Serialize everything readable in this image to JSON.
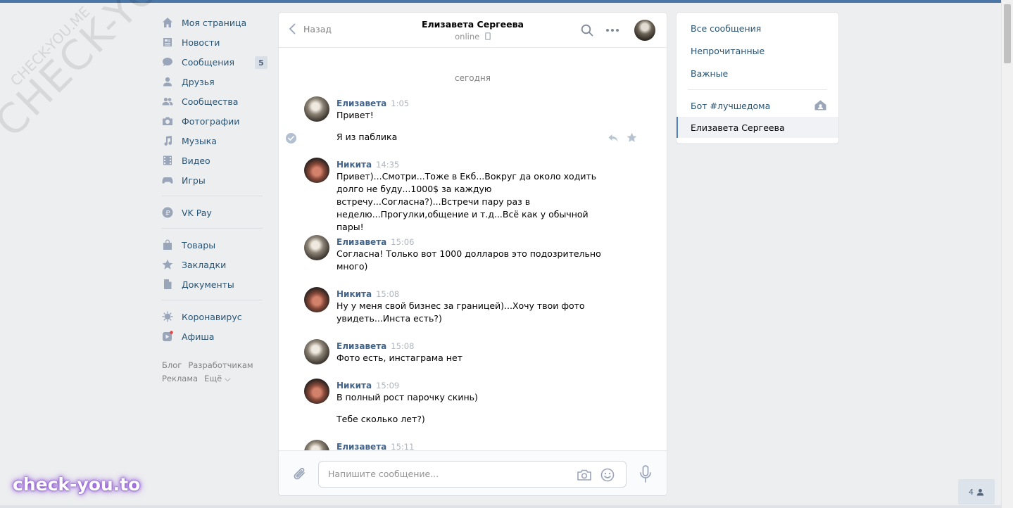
{
  "watermark": {
    "text_big": "CHECK-YOU.ME",
    "text_small": "CHECK-YOU.ME",
    "logo": "check-you.to"
  },
  "leftnav": {
    "items": [
      {
        "label": "Моя страница",
        "icon": "home-icon"
      },
      {
        "label": "Новости",
        "icon": "news-icon"
      },
      {
        "label": "Сообщения",
        "icon": "messages-icon",
        "badge": "5"
      },
      {
        "label": "Друзья",
        "icon": "friends-icon"
      },
      {
        "label": "Сообщества",
        "icon": "groups-icon"
      },
      {
        "label": "Фотографии",
        "icon": "camera-icon"
      },
      {
        "label": "Музыка",
        "icon": "music-icon"
      },
      {
        "label": "Видео",
        "icon": "video-icon"
      },
      {
        "label": "Игры",
        "icon": "games-icon"
      },
      {
        "label": "VK Pay",
        "icon": "vkpay-icon"
      },
      {
        "label": "Товары",
        "icon": "bag-icon"
      },
      {
        "label": "Закладки",
        "icon": "star-icon"
      },
      {
        "label": "Документы",
        "icon": "document-icon"
      },
      {
        "label": "Коронавирус",
        "icon": "virus-icon"
      },
      {
        "label": "Афиша",
        "icon": "afisha-icon"
      }
    ],
    "footer": {
      "blog": "Блог",
      "dev": "Разработчикам",
      "ads": "Реклама",
      "more": "Ещё ⌵"
    }
  },
  "chat": {
    "back": "Назад",
    "peer_name": "Елизавета Сергеева",
    "peer_status": "online",
    "date_label": "сегодня",
    "messages": [
      {
        "author": "Елизавета",
        "time": "1:05",
        "text": "Привет!",
        "text2": "Я из паблика"
      },
      {
        "author": "Никита",
        "time": "14:35",
        "text": "Привет)...Смотри...Тоже в Екб...Вокруг да около ходить долго не буду...1000$ за каждую встречу...Согласна?)...Встречи пару раз в неделю...Прогулки,общение и т.д...Всё как у обычной пары!"
      },
      {
        "author": "Елизавета",
        "time": "15:06",
        "text": "Согласна! Только вот 1000 долларов это подозрительно много)"
      },
      {
        "author": "Никита",
        "time": "15:08",
        "text": "Ну у меня свой бизнес за границей)...Хочу твои фото увидеть...Инста есть?)"
      },
      {
        "author": "Елизавета",
        "time": "15:08",
        "text": "Фото есть, инстаграма нет"
      },
      {
        "author": "Никита",
        "time": "15:09",
        "text": "В полный рост парочку скинь)",
        "text2": "Тебе сколько лет?)"
      },
      {
        "author": "Елизавета",
        "time": "15:11",
        "text": ""
      }
    ],
    "composer_placeholder": "Напишите сообщение..."
  },
  "right": {
    "all": "Все сообщения",
    "unread": "Непрочитанные",
    "important": "Важные",
    "bot": "Бот #лучшедома",
    "active": "Елизавета Сергеева"
  },
  "corner": {
    "count": "4"
  },
  "colors": {
    "accent": "#4a76a8",
    "link": "#285473",
    "author": "#42648b"
  }
}
